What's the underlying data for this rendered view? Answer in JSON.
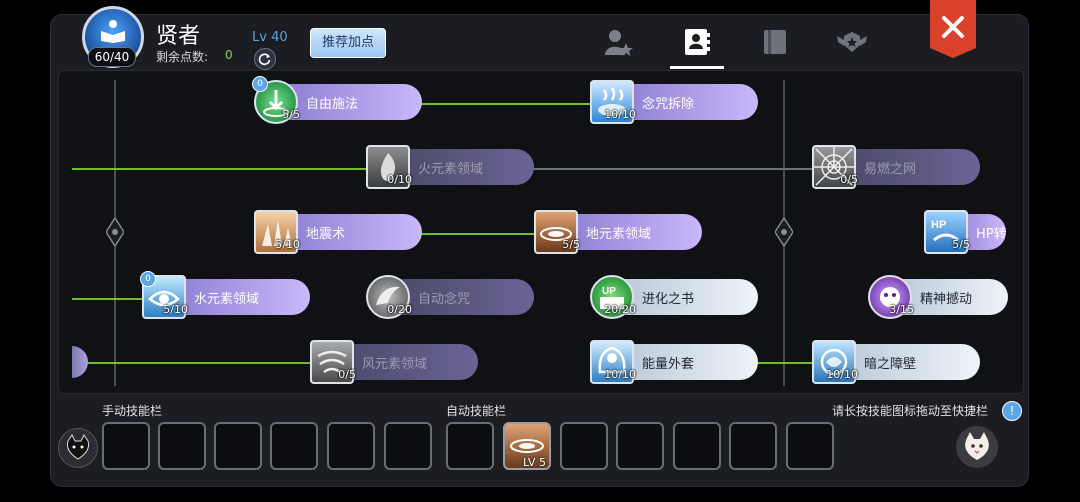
{
  "header": {
    "class_name": "贤者",
    "avatar_level": "60/40",
    "points_label": "剩余点数:",
    "points_value": "0",
    "level": "Lv 40",
    "recommend_button": "推荐加点"
  },
  "tabs": [
    "person-star-icon",
    "contact-book-icon",
    "book-icon",
    "emblem-icon"
  ],
  "skills": [
    {
      "name": "自由施法",
      "level": "5/5",
      "active": true,
      "color": "purple",
      "badge": "0"
    },
    {
      "name": "念咒拆除",
      "level": "10/10",
      "active": true,
      "color": "purple"
    },
    {
      "name": "火元素领域",
      "level": "0/10",
      "active": false,
      "color": "dim"
    },
    {
      "name": "易燃之网",
      "level": "0/5",
      "active": false,
      "color": "dim"
    },
    {
      "name": "地震术",
      "level": "5/10",
      "active": true,
      "color": "purple"
    },
    {
      "name": "地元素领域",
      "level": "5/5",
      "active": true,
      "color": "purple"
    },
    {
      "name": "HP转",
      "level": "5/5",
      "active": true,
      "color": "purple"
    },
    {
      "name": "水元素领域",
      "level": "5/10",
      "active": true,
      "color": "purple",
      "badge": "0"
    },
    {
      "name": "自动念咒",
      "level": "0/20",
      "active": false,
      "color": "dim"
    },
    {
      "name": "进化之书",
      "level": "20/20",
      "active": true,
      "color": "white"
    },
    {
      "name": "精神撼动",
      "level": "3/15",
      "active": true,
      "color": "white"
    },
    {
      "name": "风元素领域",
      "level": "0/5",
      "active": false,
      "color": "dim"
    },
    {
      "name": "能量外套",
      "level": "10/10",
      "active": true,
      "color": "white"
    },
    {
      "name": "暗之障壁",
      "level": "10/10",
      "active": true,
      "color": "white"
    }
  ],
  "bottom": {
    "manual_label": "手动技能栏",
    "auto_label": "自动技能栏",
    "hint": "请长按技能图标拖动至快捷栏",
    "auto_slot_level": "LV 5"
  },
  "colors": {
    "green_line": "#6fbf2a",
    "purple_bar": "#b9a5f2",
    "white_bar": "#dfe9f3",
    "dim_bar": "#5a5778",
    "close": "#d9412a"
  }
}
